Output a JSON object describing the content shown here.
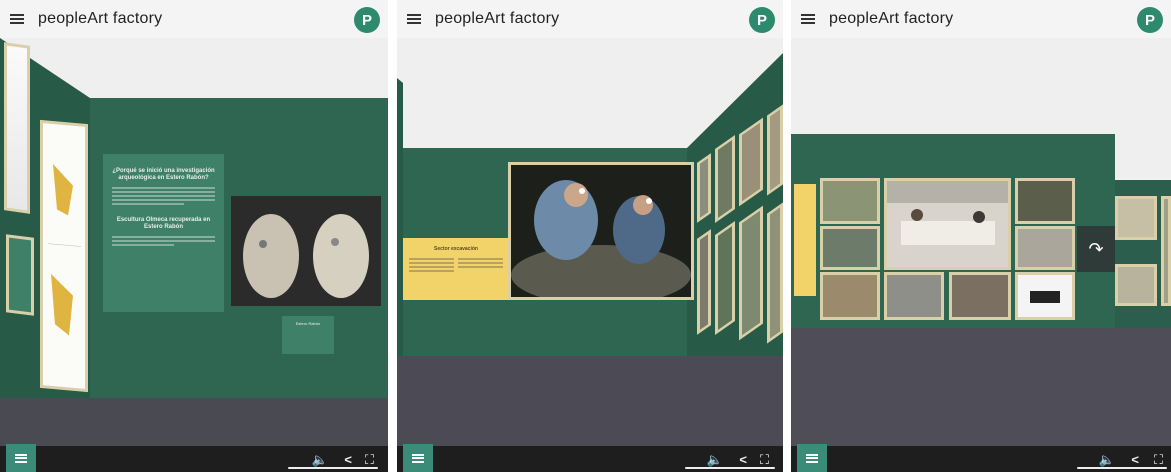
{
  "app": {
    "brand": "peopleArt factory",
    "avatar_letter": "P"
  },
  "panels": [
    {
      "id": "p1",
      "board": {
        "heading1": "¿Porqué se inició una investigación arqueológica en Estero Rabón?",
        "heading2": "Escultura Olmeca recuperada en Estero Rabón",
        "small_card_title": "Estero Rabón"
      }
    },
    {
      "id": "p2",
      "yellow_title": "Sector excavación"
    },
    {
      "id": "p3"
    }
  ],
  "controls": {
    "sound": "🔈",
    "share": "<",
    "fullscreen": "⛶"
  },
  "colors": {
    "wall": "#2f6652",
    "floor": "#4a4a52",
    "accent": "#2e8a6c",
    "frame": "#d9cfa9",
    "yellow": "#f2d36a"
  },
  "icons": [
    "menu-icon",
    "speaker-icon",
    "share-icon",
    "fullscreen-icon",
    "forward-arrow-icon"
  ]
}
